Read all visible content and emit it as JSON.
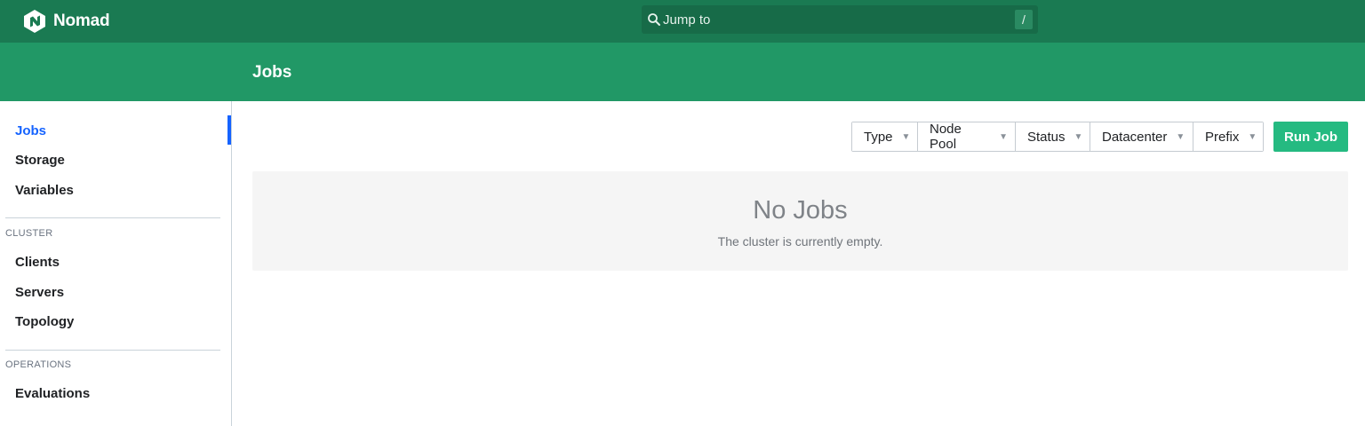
{
  "app": {
    "name": "Nomad",
    "logo_icon": "nomad-logo-icon"
  },
  "search": {
    "placeholder": "Jump to",
    "shortcut": "/",
    "icon": "search-icon"
  },
  "header": {
    "title": "Jobs"
  },
  "sidebar": {
    "items": [
      {
        "label": "Jobs",
        "active": true
      },
      {
        "label": "Storage"
      },
      {
        "label": "Variables"
      }
    ],
    "cluster_heading": "CLUSTER",
    "cluster_items": [
      {
        "label": "Clients"
      },
      {
        "label": "Servers"
      },
      {
        "label": "Topology"
      }
    ],
    "operations_heading": "OPERATIONS",
    "operations_items": [
      {
        "label": "Evaluations"
      }
    ]
  },
  "filters": [
    {
      "label": "Type"
    },
    {
      "label": "Node Pool"
    },
    {
      "label": "Status"
    },
    {
      "label": "Datacenter"
    },
    {
      "label": "Prefix"
    }
  ],
  "actions": {
    "run_job": "Run Job"
  },
  "empty_state": {
    "title": "No Jobs",
    "message": "The cluster is currently empty."
  },
  "colors": {
    "topbar": "#1a7a52",
    "subheader": "#219866",
    "accent": "#1563ff",
    "primary_button": "#25ba81"
  }
}
